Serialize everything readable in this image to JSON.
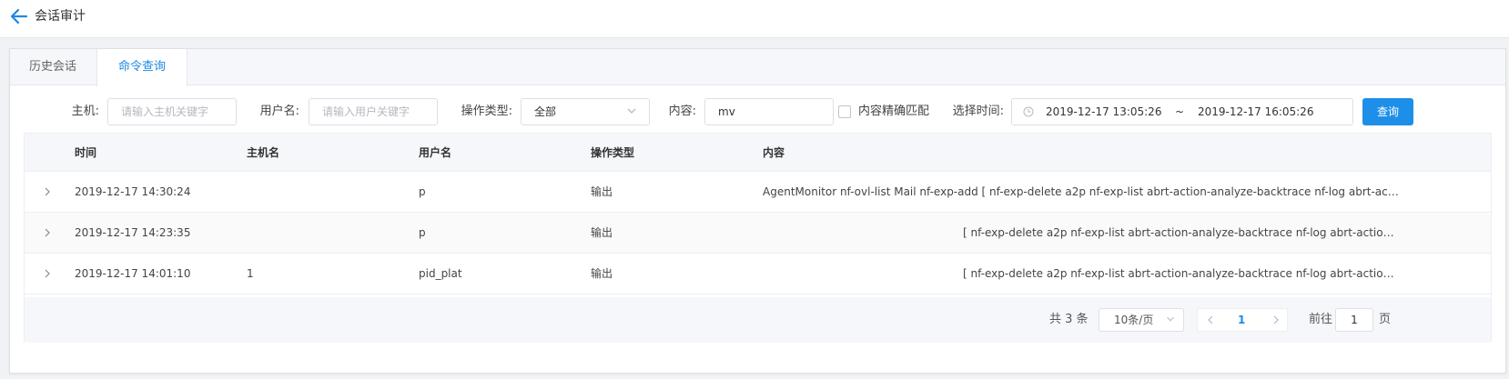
{
  "header": {
    "title": "会话审计",
    "back_icon": "arrow-left-icon"
  },
  "tabs": [
    {
      "label": "历史会话",
      "active": false
    },
    {
      "label": "命令查询",
      "active": true
    }
  ],
  "filters": {
    "host_label": "主机:",
    "host_placeholder": "请输入主机关键字",
    "user_label": "用户名:",
    "user_placeholder": "请输入用户关键字",
    "optype_label": "操作类型:",
    "optype_value": "全部",
    "content_label": "内容:",
    "content_value": "mv",
    "exact_match_label": "内容精确匹配",
    "exact_match_checked": false,
    "time_label": "选择时间:",
    "time_start": "2019-12-17 13:05:26",
    "time_separator": "~",
    "time_end": "2019-12-17 16:05:26",
    "query_button": "查询"
  },
  "table": {
    "columns": [
      "时间",
      "主机名",
      "用户名",
      "操作类型",
      "内容"
    ],
    "rows": [
      {
        "time": "2019-12-17 14:30:24",
        "host": "",
        "user": "p",
        "optype": "输出",
        "content": "AgentMonitor nf-ovl-list Mail nf-exp-add [ nf-exp-delete a2p nf-exp-list abrt-action-analyze-backtrace nf-log abrt-action-anal..."
      },
      {
        "time": "2019-12-17 14:23:35",
        "host": "",
        "user": "p",
        "optype": "输出",
        "content": "[ nf-exp-delete a2p nf-exp-list abrt-action-analyze-backtrace nf-log abrt-action-anal..."
      },
      {
        "time": "2019-12-17 14:01:10",
        "host": "1",
        "user": "pid_plat",
        "optype": "输出",
        "content": "[ nf-exp-delete a2p nf-exp-list abrt-action-analyze-backtrace nf-log abrt-action-anal..."
      }
    ]
  },
  "pagination": {
    "total": "共 3 条",
    "page_size": "10条/页",
    "current_page": "1",
    "goto_label": "前往",
    "goto_value": "1",
    "page_suffix": "页"
  },
  "colors": {
    "accent": "#1e88e5",
    "button": "#1e8fe8"
  }
}
